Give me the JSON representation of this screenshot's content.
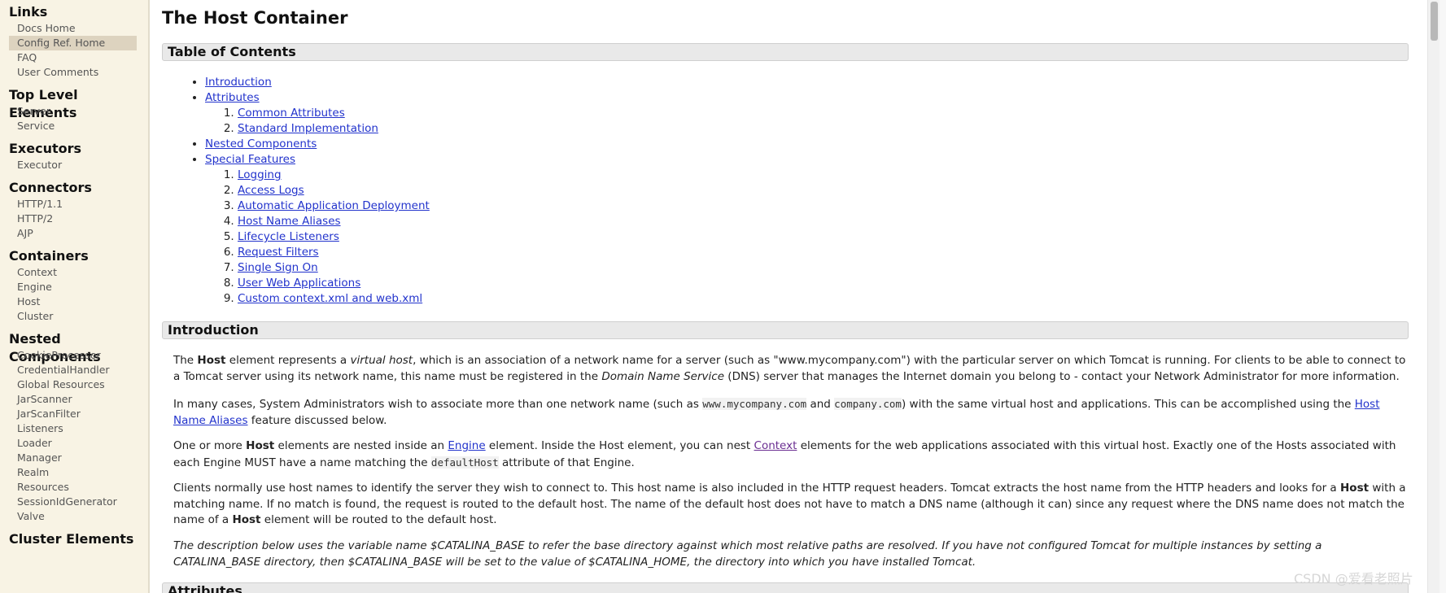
{
  "sidebar": {
    "sections": [
      {
        "heading": "Links",
        "items": [
          "Docs Home",
          "Config Ref. Home",
          "FAQ",
          "User Comments"
        ]
      },
      {
        "heading": "Top Level Elements",
        "items": [
          "Server",
          "Service"
        ]
      },
      {
        "heading": "Executors",
        "items": [
          "Executor"
        ]
      },
      {
        "heading": "Connectors",
        "items": [
          "HTTP/1.1",
          "HTTP/2",
          "AJP"
        ]
      },
      {
        "heading": "Containers",
        "items": [
          "Context",
          "Engine",
          "Host",
          "Cluster"
        ]
      },
      {
        "heading": "Nested Components",
        "items": [
          "CookieProcessor",
          "CredentialHandler",
          "Global Resources",
          "JarScanner",
          "JarScanFilter",
          "Listeners",
          "Loader",
          "Manager",
          "Realm",
          "Resources",
          "SessionIdGenerator",
          "Valve"
        ]
      },
      {
        "heading": "Cluster Elements",
        "items": []
      }
    ],
    "active_item": "Config Ref. Home"
  },
  "page": {
    "title": "The Host Container",
    "toc_heading": "Table of Contents",
    "toc": {
      "introduction": "Introduction",
      "attributes": "Attributes",
      "attributes_sub": [
        "Common Attributes",
        "Standard Implementation"
      ],
      "nested": "Nested Components",
      "special": "Special Features",
      "special_sub": [
        "Logging",
        "Access Logs",
        "Automatic Application Deployment",
        "Host Name Aliases",
        "Lifecycle Listeners",
        "Request Filters",
        "Single Sign On",
        "User Web Applications",
        "Custom context.xml and web.xml"
      ]
    },
    "intro_heading": "Introduction",
    "p1": {
      "t1": "The ",
      "b1": "Host",
      "t2": " element represents a ",
      "i1": "virtual host",
      "t3": ", which is an association of a network name for a server (such as \"www.mycompany.com\") with the particular server on which Tomcat is running. For clients to be able to connect to a Tomcat server using its network name, this name must be registered in the ",
      "i2": "Domain Name Service",
      "t4": " (DNS) server that manages the Internet domain you belong to - contact your Network Administrator for more information."
    },
    "p2": {
      "t1": "In many cases, System Administrators wish to associate more than one network name (such as ",
      "c1": "www.mycompany.com",
      "t2": " and ",
      "c2": "company.com",
      "t3": ") with the same virtual host and applications. This can be accomplished using the ",
      "a1": "Host Name Aliases",
      "t4": " feature discussed below."
    },
    "p3": {
      "t1": "One or more ",
      "b1": "Host",
      "t2": " elements are nested inside an ",
      "a1": "Engine",
      "t3": " element. Inside the Host element, you can nest ",
      "a2": "Context",
      "t4": " elements for the web applications associated with this virtual host. Exactly one of the Hosts associated with each Engine MUST have a name matching the ",
      "c1": "defaultHost",
      "t5": " attribute of that Engine."
    },
    "p4": {
      "t1": "Clients normally use host names to identify the server they wish to connect to. This host name is also included in the HTTP request headers. Tomcat extracts the host name from the HTTP headers and looks for a ",
      "b1": "Host",
      "t2": " with a matching name. If no match is found, the request is routed to the default host. The name of the default host does not have to match a DNS name (although it can) since any request where the DNS name does not match the name of a ",
      "b2": "Host",
      "t3": " element will be routed to the default host."
    },
    "p5": "The description below uses the variable name $CATALINA_BASE to refer the base directory against which most relative paths are resolved. If you have not configured Tomcat for multiple instances by setting a CATALINA_BASE directory, then $CATALINA_BASE will be set to the value of $CATALINA_HOME, the directory into which you have installed Tomcat.",
    "attributes_heading": "Attributes"
  },
  "watermark": "CSDN @爱看老照片"
}
